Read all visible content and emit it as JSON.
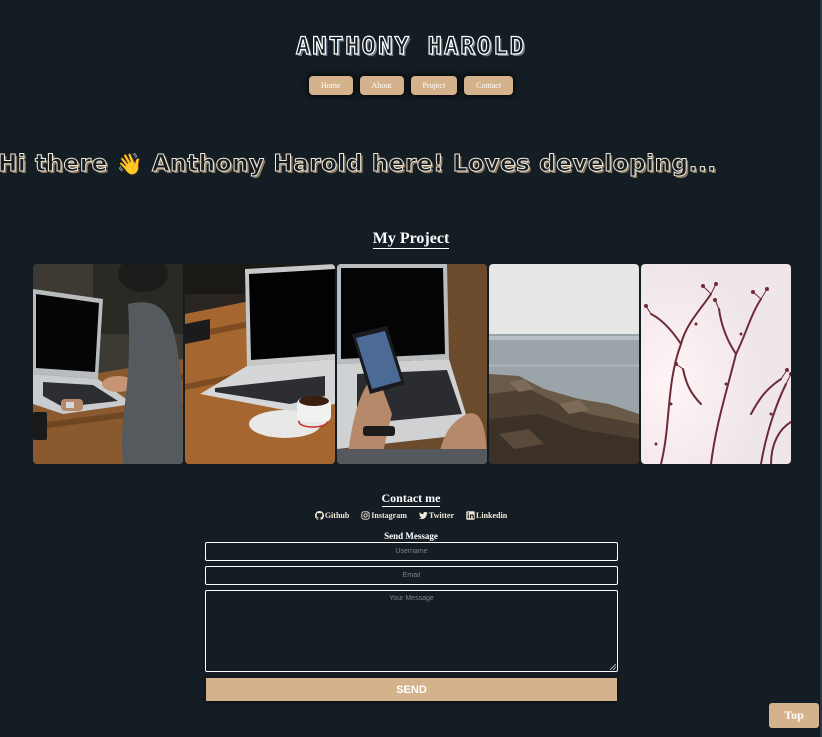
{
  "header": {
    "title": "ANTHONY HAROLD",
    "nav": [
      {
        "label": "Home"
      },
      {
        "label": "About"
      },
      {
        "label": "Project"
      },
      {
        "label": "Contact"
      }
    ]
  },
  "hero": {
    "before": "Hi there ",
    "emoji": "👋",
    "after": " Anthony Harold here! Loves developing..."
  },
  "projects": {
    "title": "My Project",
    "images": [
      {
        "icon": "laptop-typing-photo"
      },
      {
        "icon": "laptop-coffee-photo"
      },
      {
        "icon": "phone-laptop-photo"
      },
      {
        "icon": "rocky-seashore-photo"
      },
      {
        "icon": "branches-sky-photo"
      }
    ]
  },
  "contact": {
    "title": "Contact me",
    "socials": [
      {
        "label": "Github",
        "icon": "github-icon"
      },
      {
        "label": "Instagram",
        "icon": "instagram-icon"
      },
      {
        "label": "Twitter",
        "icon": "twitter-icon"
      },
      {
        "label": "Linkedin",
        "icon": "linkedin-icon"
      }
    ],
    "form": {
      "title": "Send Message",
      "username_placeholder": "Username",
      "email_placeholder": "Email",
      "message_placeholder": "Your Message",
      "send_label": "SEND"
    }
  },
  "top_button": "Top",
  "colors": {
    "background": "#141d23",
    "accent": "#d4b38c",
    "text": "#ffffff"
  }
}
